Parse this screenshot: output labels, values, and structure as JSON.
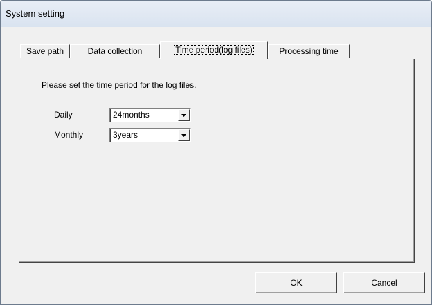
{
  "window": {
    "title": "System setting"
  },
  "tabs": [
    {
      "label": "Save path",
      "active": false
    },
    {
      "label": "Data collection",
      "active": false
    },
    {
      "label": "Time period(log files)",
      "active": true
    },
    {
      "label": "Processing time",
      "active": false
    }
  ],
  "panel": {
    "instruction": "Please set the time period for the log files.",
    "daily": {
      "label": "Daily",
      "value": "24months",
      "icon": "chevron-down-icon"
    },
    "monthly": {
      "label": "Monthly",
      "value": "3years",
      "icon": "chevron-down-icon"
    }
  },
  "buttons": {
    "ok": "OK",
    "cancel": "Cancel"
  },
  "colors": {
    "face": "#f0f0f0",
    "titlebar": "#dde6f2",
    "shadow": "#404040",
    "highlight": "#ffffff"
  }
}
